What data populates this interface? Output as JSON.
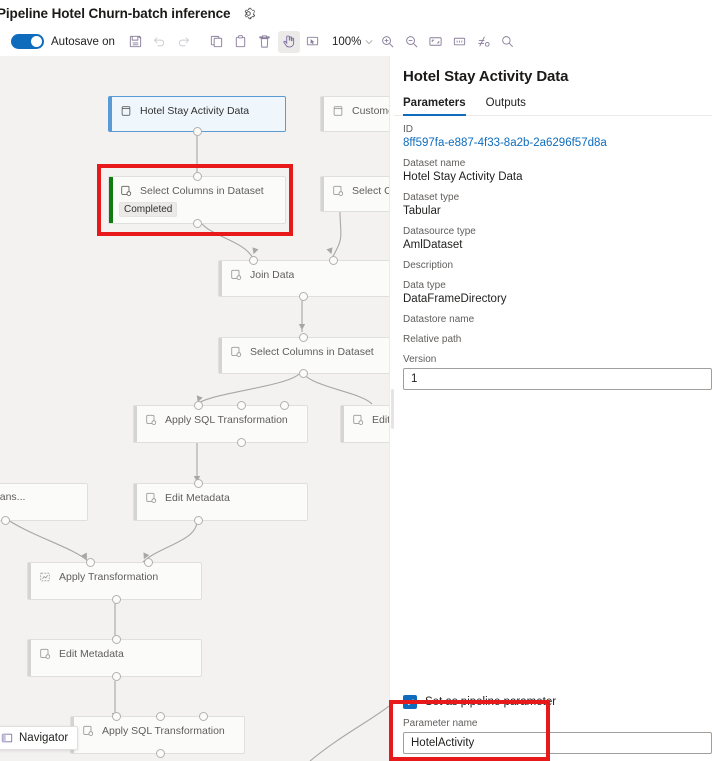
{
  "titlebar": {
    "title": "Pipeline Hotel Churn-batch inference",
    "settings_icon": "gear-icon"
  },
  "toolbar": {
    "autosave_label": "Autosave on",
    "autosave_state": "on",
    "zoom_level": "100%",
    "buttons": [
      {
        "name": "save-icon",
        "label": "Save"
      },
      {
        "name": "undo-icon",
        "label": "Undo"
      },
      {
        "name": "redo-icon",
        "label": "Redo"
      },
      {
        "name": "copy-icon",
        "label": "Copy"
      },
      {
        "name": "paste-icon",
        "label": "Paste"
      },
      {
        "name": "delete-icon",
        "label": "Delete"
      },
      {
        "name": "pan-hand-icon",
        "label": "Pan"
      },
      {
        "name": "select-region-icon",
        "label": "Select"
      },
      {
        "name": "zoom-in-icon",
        "label": "Zoom in"
      },
      {
        "name": "zoom-out-icon",
        "label": "Zoom out"
      },
      {
        "name": "fit-to-screen-icon",
        "label": "Fit to screen"
      },
      {
        "name": "actual-size-icon",
        "label": "Actual size"
      },
      {
        "name": "auto-layout-icon",
        "label": "Auto layout"
      },
      {
        "name": "search-icon",
        "label": "Search"
      }
    ]
  },
  "canvas": {
    "navigator_label": "Navigator",
    "nodes": [
      {
        "id": "n1",
        "label": "Hotel Stay Activity Data",
        "icon": "dataset-icon",
        "state": "selected",
        "status": null
      },
      {
        "id": "n2",
        "label": "Customer Dat",
        "icon": "dataset-icon",
        "state": "normal",
        "status": null
      },
      {
        "id": "n3",
        "label": "Select Columns in Dataset",
        "icon": "module-icon",
        "state": "completed",
        "status": "Completed"
      },
      {
        "id": "n4",
        "label": "Select Colum",
        "icon": "module-icon",
        "state": "normal",
        "status": null
      },
      {
        "id": "n5",
        "label": "Join Data",
        "icon": "module-icon",
        "state": "normal",
        "status": null
      },
      {
        "id": "n6",
        "label": "Select Columns in Dataset",
        "icon": "module-icon",
        "state": "normal",
        "status": null
      },
      {
        "id": "n7",
        "label": "Apply SQL Transformation",
        "icon": "module-icon",
        "state": "normal",
        "status": null
      },
      {
        "id": "n8",
        "label": "Edit M",
        "icon": "module-icon",
        "state": "normal",
        "status": null
      },
      {
        "id": "n9",
        "label": "tor Values Trans...",
        "icon": "none",
        "state": "normal",
        "status": null
      },
      {
        "id": "n10",
        "label": "Edit Metadata",
        "icon": "module-icon",
        "state": "normal",
        "status": null
      },
      {
        "id": "n11",
        "label": "Apply Transformation",
        "icon": "transform-icon",
        "state": "normal",
        "status": null
      },
      {
        "id": "n12",
        "label": "Edit Metadata",
        "icon": "module-icon",
        "state": "normal",
        "status": null
      },
      {
        "id": "n13",
        "label": "Apply SQL Transformation",
        "icon": "module-icon",
        "state": "normal",
        "status": null
      }
    ]
  },
  "panel": {
    "title": "Hotel Stay Activity Data",
    "tabs": [
      {
        "label": "Parameters",
        "active": true
      },
      {
        "label": "Outputs",
        "active": false
      }
    ],
    "fields": [
      {
        "label": "ID",
        "value": "8ff597fa-e887-4f33-8a2b-2a6296f57d8a",
        "style": "link"
      },
      {
        "label": "Dataset name",
        "value": "Hotel Stay Activity Data",
        "style": "text"
      },
      {
        "label": "Dataset type",
        "value": "Tabular",
        "style": "text"
      },
      {
        "label": "Datasource type",
        "value": "AmlDataset",
        "style": "text"
      },
      {
        "label": "Description",
        "value": "",
        "style": "text"
      },
      {
        "label": "Data type",
        "value": "DataFrameDirectory",
        "style": "text"
      },
      {
        "label": "Datastore name",
        "value": "",
        "style": "text"
      },
      {
        "label": "Relative path",
        "value": "",
        "style": "text"
      }
    ],
    "version": {
      "label": "Version",
      "value": "1"
    },
    "pipeline_parameter": {
      "checkbox_label": "Set as pipeline parameter",
      "checked": true,
      "param_name_label": "Parameter name",
      "param_name_value": "HotelActivity"
    }
  },
  "colors": {
    "accent": "#0f6cbd",
    "highlight_red": "#e8191a",
    "status_green": "#107c10",
    "canvas_bg": "#f3f2f1",
    "link": "#0f6cbd"
  }
}
